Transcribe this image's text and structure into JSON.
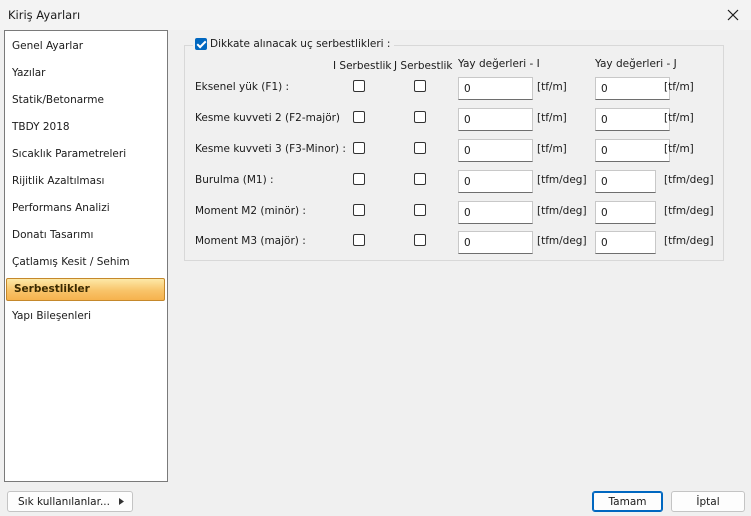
{
  "window": {
    "title": "Kiriş Ayarları"
  },
  "sidebar": {
    "items": [
      {
        "label": "Genel Ayarlar",
        "selected": false
      },
      {
        "label": "Yazılar",
        "selected": false
      },
      {
        "label": "Statik/Betonarme",
        "selected": false
      },
      {
        "label": "TBDY 2018",
        "selected": false
      },
      {
        "label": "Sıcaklık Parametreleri",
        "selected": false
      },
      {
        "label": "Rijitlik Azaltılması",
        "selected": false
      },
      {
        "label": "Performans Analizi",
        "selected": false
      },
      {
        "label": "Donatı Tasarımı",
        "selected": false
      },
      {
        "label": "Çatlamış Kesit / Sehim",
        "selected": false
      },
      {
        "label": "Serbestlikler",
        "selected": true
      },
      {
        "label": "Yapı Bileşenleri",
        "selected": false
      }
    ]
  },
  "releases": {
    "group_label": "Dikkate alınacak uç serbestlikleri :",
    "group_checked": true,
    "headers": {
      "i_release": "I Serbestlik",
      "j_release": "J Serbestlik",
      "spring_i": "Yay değerleri - I",
      "spring_j": "Yay değerleri - J"
    },
    "rows": [
      {
        "label": "Eksenel yük (F1) :",
        "i_checked": false,
        "j_checked": false,
        "spring_i": "0",
        "unit_i": "[tf/m]",
        "spring_j": "0",
        "unit_j": "[tf/m]"
      },
      {
        "label": "Kesme kuvveti 2 (F2-majör)",
        "i_checked": false,
        "j_checked": false,
        "spring_i": "0",
        "unit_i": "[tf/m]",
        "spring_j": "0",
        "unit_j": "[tf/m]"
      },
      {
        "label": "Kesme kuvveti 3 (F3-Minor) :",
        "i_checked": false,
        "j_checked": false,
        "spring_i": "0",
        "unit_i": "[tf/m]",
        "spring_j": "0",
        "unit_j": "[tf/m]"
      },
      {
        "label": "Burulma (M1) :",
        "i_checked": false,
        "j_checked": false,
        "spring_i": "0",
        "unit_i": "[tfm/deg]",
        "spring_j": "0",
        "unit_j": "[tfm/deg]"
      },
      {
        "label": "Moment M2 (minör) :",
        "i_checked": false,
        "j_checked": false,
        "spring_i": "0",
        "unit_i": "[tfm/deg]",
        "spring_j": "0",
        "unit_j": "[tfm/deg]"
      },
      {
        "label": "Moment M3 (majör) :",
        "i_checked": false,
        "j_checked": false,
        "spring_i": "0",
        "unit_i": "[tfm/deg]",
        "spring_j": "0",
        "unit_j": "[tfm/deg]"
      }
    ]
  },
  "footer": {
    "favorites_label": "Sık kullanılanlar...",
    "ok_label": "Tamam",
    "cancel_label": "İptal"
  }
}
